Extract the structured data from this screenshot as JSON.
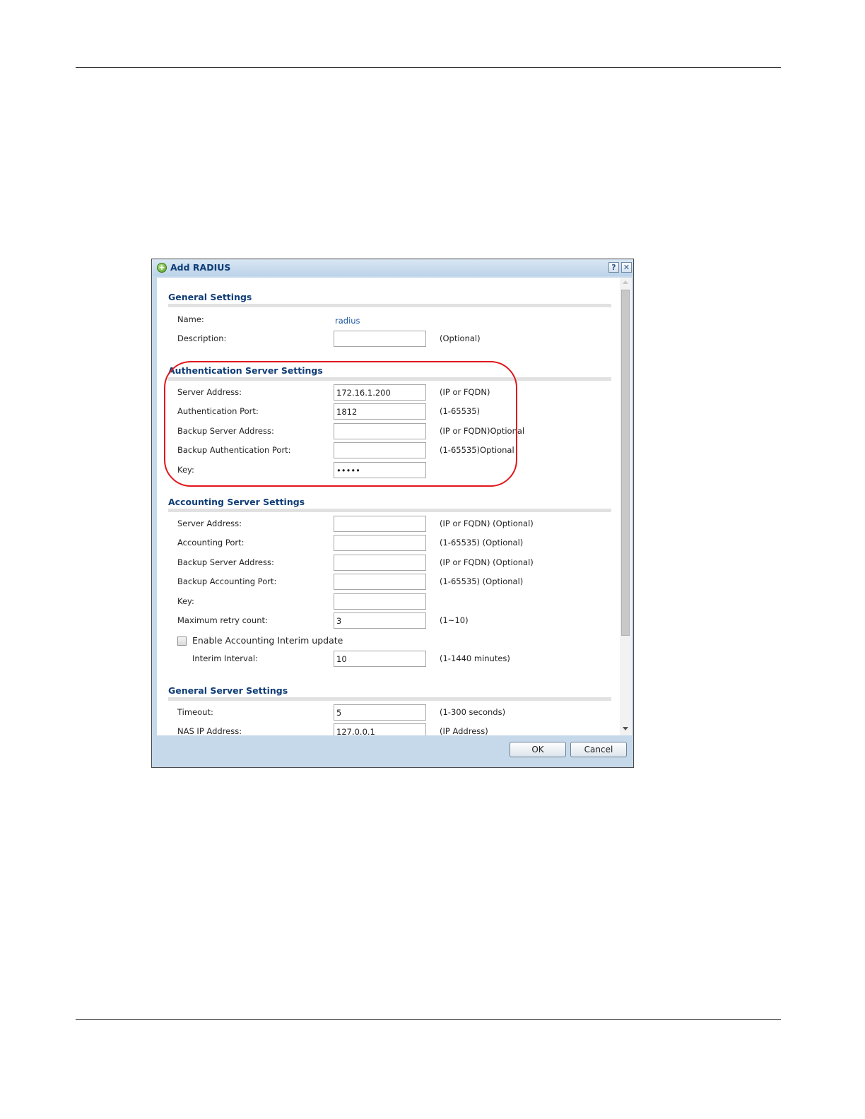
{
  "dialog": {
    "title": "Add RADIUS",
    "help_glyph": "?",
    "close_glyph": "✕",
    "title_icon": "plus-circle-icon"
  },
  "general_settings": {
    "title": "General Settings",
    "name_label": "Name:",
    "name_value": "radius",
    "description_label": "Description:",
    "description_value": "",
    "description_hint": "(Optional)"
  },
  "auth_server": {
    "title": "Authentication Server Settings",
    "rows": [
      {
        "label": "Server Address:",
        "value": "172.16.1.200",
        "hint": "(IP or FQDN)"
      },
      {
        "label": "Authentication Port:",
        "value": "1812",
        "hint": "(1-65535)"
      },
      {
        "label": "Backup Server Address:",
        "value": "",
        "hint": "(IP or FQDN)Optional"
      },
      {
        "label": "Backup Authentication Port:",
        "value": "",
        "hint": "(1-65535)Optional"
      },
      {
        "label": "Key:",
        "value": "•••••",
        "hint": ""
      }
    ]
  },
  "accounting_server": {
    "title": "Accounting Server Settings",
    "rows": [
      {
        "label": "Server Address:",
        "value": "",
        "hint": "(IP or FQDN) (Optional)"
      },
      {
        "label": "Accounting Port:",
        "value": "",
        "hint": "(1-65535) (Optional)"
      },
      {
        "label": "Backup Server Address:",
        "value": "",
        "hint": "(IP or FQDN) (Optional)"
      },
      {
        "label": "Backup Accounting Port:",
        "value": "",
        "hint": "(1-65535) (Optional)"
      },
      {
        "label": "Key:",
        "value": "",
        "hint": ""
      },
      {
        "label": "Maximum retry count:",
        "value": "3",
        "hint": "(1~10)"
      }
    ],
    "interim_checkbox_label": "Enable Accounting Interim update",
    "interim_checked": false,
    "interim_interval_label": "Interim Interval:",
    "interim_interval_value": "10",
    "interim_interval_hint": "(1-1440 minutes)"
  },
  "general_server": {
    "title": "General Server Settings",
    "rows": [
      {
        "label": "Timeout:",
        "value": "5",
        "hint": "(1-300 seconds)"
      },
      {
        "label": "NAS IP Address:",
        "value": "127.0.0.1",
        "hint": "(IP Address)"
      }
    ]
  },
  "footer": {
    "ok_label": "OK",
    "cancel_label": "Cancel"
  }
}
